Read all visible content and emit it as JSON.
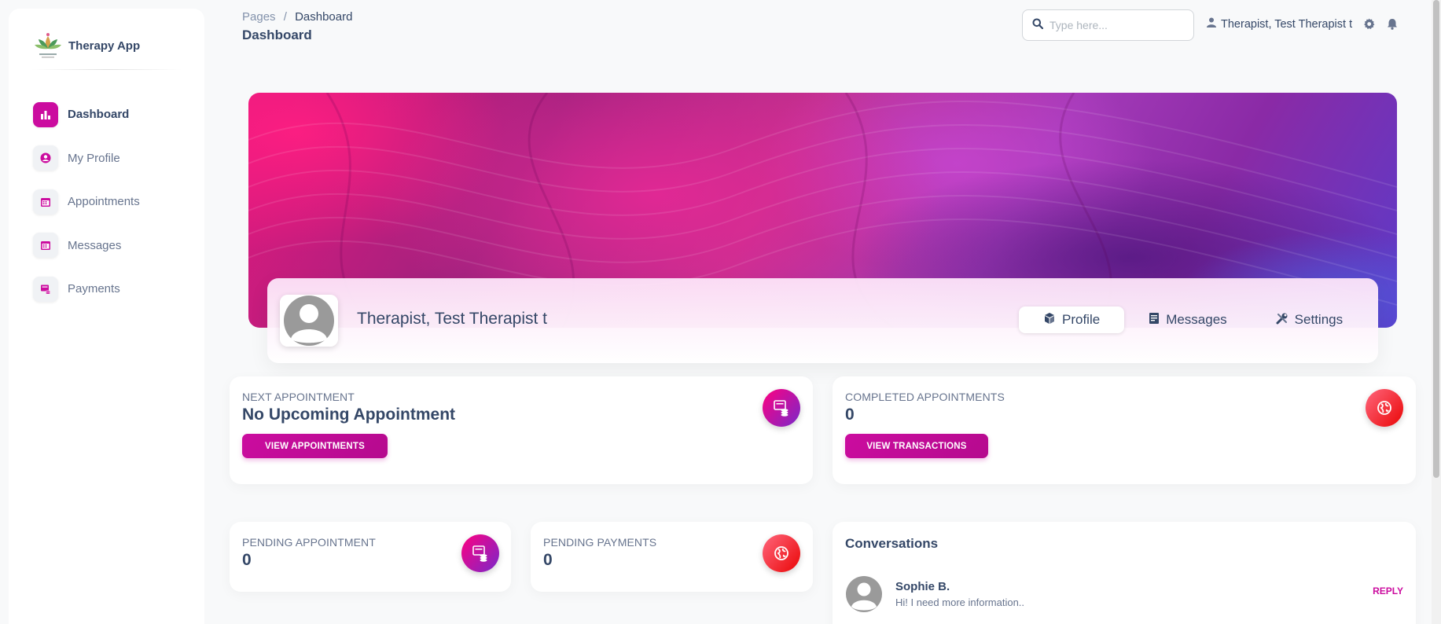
{
  "sidebar": {
    "brand_name": "Therapy App",
    "items": [
      {
        "label": "Dashboard",
        "icon": "bar-chart-icon",
        "active": true
      },
      {
        "label": "My Profile",
        "icon": "user-circle-icon"
      },
      {
        "label": "Appointments",
        "icon": "calendar-icon"
      },
      {
        "label": "Messages",
        "icon": "calendar-icon"
      },
      {
        "label": "Payments",
        "icon": "payment-icon"
      }
    ]
  },
  "header": {
    "breadcrumb_root": "Pages",
    "breadcrumb_sep": "/",
    "breadcrumb_current": "Dashboard",
    "page_title": "Dashboard",
    "search_placeholder": "Type here...",
    "user_name": "Therapist, Test Therapist t"
  },
  "profile": {
    "name": "Therapist, Test Therapist t",
    "tabs": [
      {
        "label": "Profile",
        "icon": "cube-icon",
        "active": true
      },
      {
        "label": "Messages",
        "icon": "document-icon"
      },
      {
        "label": "Settings",
        "icon": "tools-icon"
      }
    ]
  },
  "cards": {
    "next_appointment": {
      "label": "Next Appointment",
      "value": "No Upcoming Appointment",
      "button": "VIEW APPOINTMENTS"
    },
    "completed_appointments": {
      "label": "Completed Appointments",
      "value": "0",
      "button": "VIEW TRANSACTIONS"
    },
    "pending_appointment": {
      "label": "Pending Appointment",
      "value": "0"
    },
    "pending_payments": {
      "label": "Pending Payments",
      "value": "0"
    }
  },
  "conversations": {
    "title": "Conversations",
    "items": [
      {
        "name": "Sophie B.",
        "message": "Hi! I need more information..",
        "action": "REPLY"
      }
    ]
  },
  "colors": {
    "accent": "#cb0c9f",
    "text_dark": "#344767",
    "text_muted": "#67748e"
  }
}
